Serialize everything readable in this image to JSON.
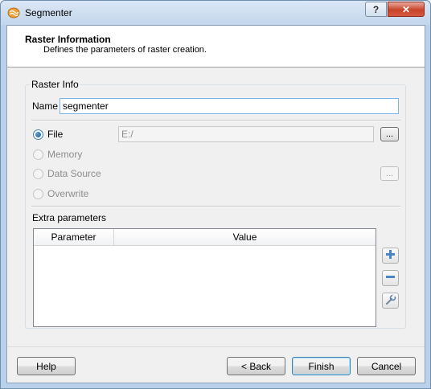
{
  "window": {
    "title": "Segmenter",
    "help_label": "?",
    "close_label": "✕"
  },
  "header": {
    "title": "Raster Information",
    "subtitle": "Defines the parameters of raster creation."
  },
  "raster_info": {
    "group_title": "Raster Info",
    "name_label": "Name",
    "name_value": "segmenter",
    "file_label": "File",
    "file_path": "E:/",
    "browse_label": "...",
    "memory_label": "Memory",
    "data_source_label": "Data Source",
    "overwrite_label": "Overwrite",
    "selected_option": "File"
  },
  "extra": {
    "title": "Extra parameters",
    "columns": [
      "Parameter",
      "Value"
    ],
    "rows": []
  },
  "buttons": {
    "help": "Help",
    "back": "< Back",
    "finish": "Finish",
    "cancel": "Cancel"
  },
  "icons": {
    "add": "plus-icon",
    "remove": "minus-icon",
    "edit": "wrench-icon"
  },
  "colors": {
    "accent": "#3c7fb1",
    "disabled_text": "#8d8d8d"
  }
}
